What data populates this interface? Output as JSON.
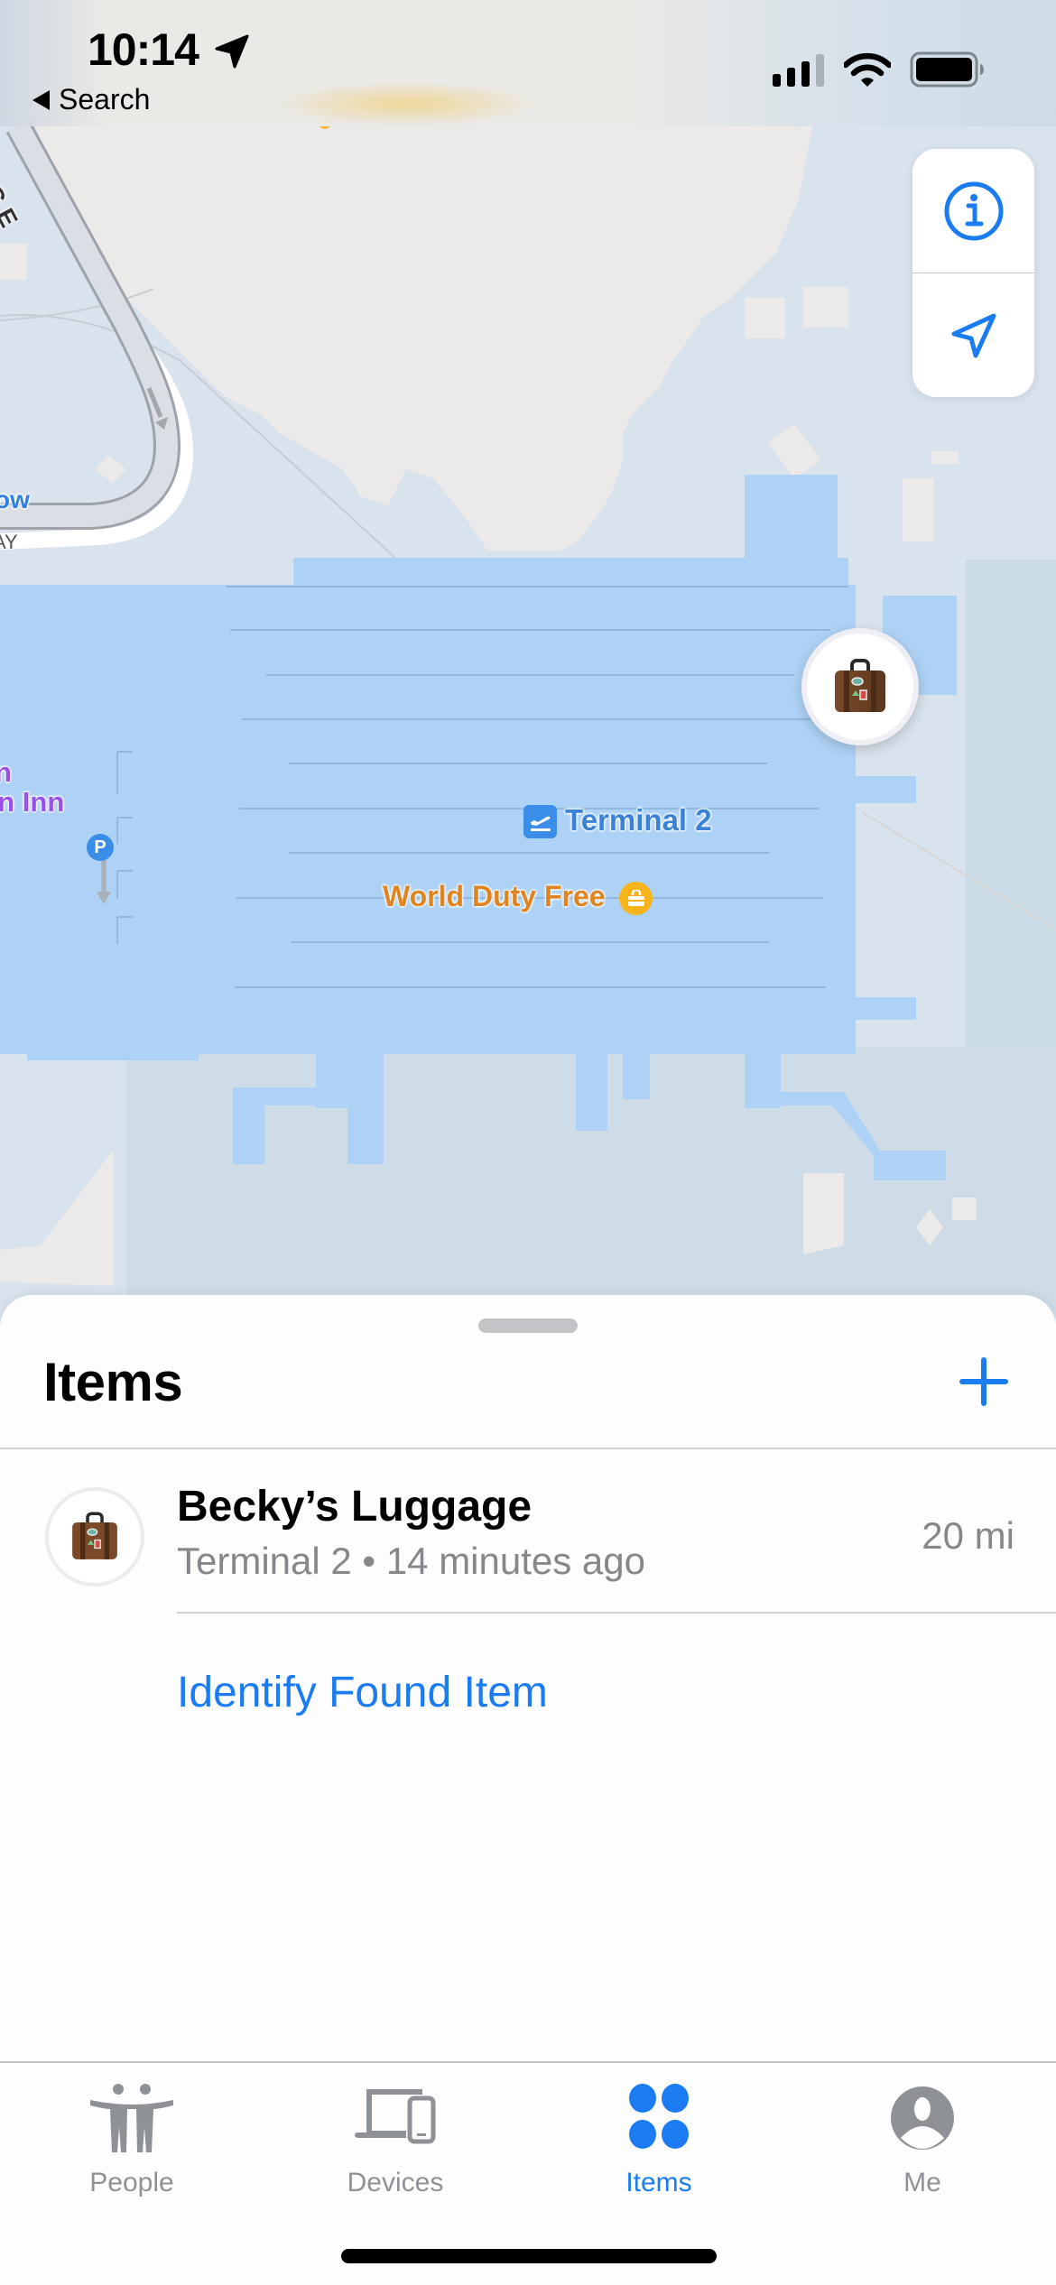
{
  "status_bar": {
    "time": "10:14",
    "back_label": "Search",
    "location_services_active": true,
    "signal_bars": 3,
    "signal_bars_total": 4,
    "battery_level": 1.0
  },
  "map": {
    "labels": {
      "terminal": "Terminal 2",
      "duty_free": "World Duty Free",
      "inn_line1": "n",
      "inn_line2": "en Inn",
      "road_ow": "ow",
      "road_ay": "AY",
      "road_inge": "ING E"
    },
    "poi_icons": {
      "terminal": "airplane-departure-icon",
      "duty_free": "shopping-bag-icon",
      "parking": "parking-icon"
    },
    "parking_symbol": "P",
    "item_pin": "suitcase-icon",
    "colors": {
      "water": "#d9e3ed",
      "terminal_fill": "#aed2f5",
      "land": "#ebeae8",
      "terminal_label": "#3b82d6",
      "duty_free_label": "#e0841f",
      "inn_label": "#9b51e8"
    }
  },
  "map_controls": {
    "info_icon": "info-circle-icon",
    "locate_icon": "location-arrow-icon"
  },
  "sheet": {
    "title": "Items",
    "add_icon": "plus-icon",
    "items": [
      {
        "name": "Becky’s Luggage",
        "location": "Terminal 2",
        "separator": "•",
        "time_ago": "14 minutes ago",
        "distance": "20 mi",
        "icon": "suitcase-icon"
      }
    ],
    "identify_link": "Identify Found Item"
  },
  "tab_bar": {
    "tabs": [
      {
        "label": "People",
        "icon": "people-icon",
        "active": false
      },
      {
        "label": "Devices",
        "icon": "devices-icon",
        "active": false
      },
      {
        "label": "Items",
        "icon": "items-icon",
        "active": true
      },
      {
        "label": "Me",
        "icon": "person-circle-icon",
        "active": false
      }
    ]
  },
  "colors": {
    "accent": "#1a7cf0",
    "secondary_text": "#86868b",
    "inactive_tab": "#8e9297"
  }
}
